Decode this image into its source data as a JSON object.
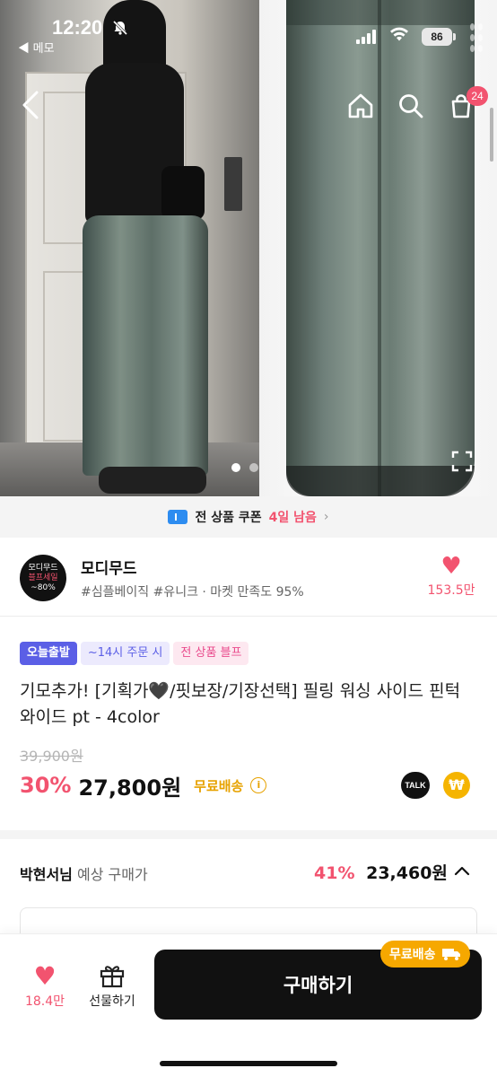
{
  "status_bar": {
    "time": "12:20",
    "back_app": "◀ 메모",
    "battery": "86"
  },
  "nav": {
    "back_icon": "chevron-left-icon",
    "home_icon": "home-icon",
    "search_icon": "search-icon",
    "cart_icon": "cart-icon",
    "cart_badge": "24"
  },
  "gallery": {
    "page_count": 2,
    "current_page": 1
  },
  "coupon_banner": {
    "text": "전 상품 쿠폰",
    "remaining": "4일 남음",
    "chevron": "›"
  },
  "store": {
    "logo_line1": "모디무드",
    "logo_line2": "블프세일",
    "logo_line3": "~80%",
    "name": "모디무드",
    "tags": "#심플베이직 #유니크 · 마켓 만족도 95%",
    "like_count": "153.5만"
  },
  "product": {
    "badges": [
      "오늘출발",
      "~14시 주문 시",
      "전 상품 블프"
    ],
    "title": "기모추가! [기획가🖤/핏보장/기장선택] 필링 워싱 사이드 핀턱 와이드 pt - 4color",
    "original_price": "39,900원",
    "discount": "30%",
    "price": "27,800원",
    "shipping": "무료배송",
    "info_icon": "i",
    "talk_label": "TALK",
    "won_symbol": "₩"
  },
  "member": {
    "name": "박현서님",
    "label": "예상 구매가",
    "discount": "41%",
    "price": "23,460원"
  },
  "bottom_bar": {
    "like_count": "18.4만",
    "gift_label": "선물하기",
    "buy_label": "구매하기",
    "ship_chip": "무료배송"
  },
  "colors": {
    "accent_pink": "#f2536f",
    "free_ship": "#e7a200",
    "today_badge": "#5b5fe6"
  }
}
